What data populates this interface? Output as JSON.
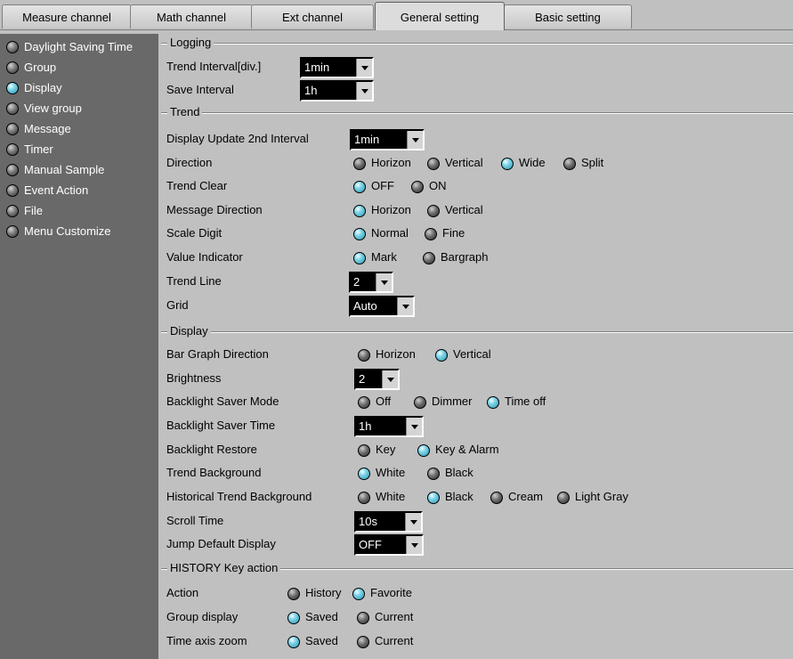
{
  "tabs": [
    "Measure channel",
    "Math channel",
    "Ext channel",
    "General setting",
    "Basic setting"
  ],
  "active_tab": "General setting",
  "sidebar": {
    "items": [
      {
        "label": "Daylight Saving Time",
        "selected": false
      },
      {
        "label": "Group",
        "selected": false
      },
      {
        "label": "Display",
        "selected": true
      },
      {
        "label": "View group",
        "selected": false
      },
      {
        "label": "Message",
        "selected": false
      },
      {
        "label": "Timer",
        "selected": false
      },
      {
        "label": "Manual Sample",
        "selected": false
      },
      {
        "label": "Event Action",
        "selected": false
      },
      {
        "label": "File",
        "selected": false
      },
      {
        "label": "Menu Customize",
        "selected": false
      }
    ]
  },
  "sections": {
    "logging": {
      "title": "Logging",
      "trend_interval": {
        "label": "Trend Interval[div.]",
        "value": "1min"
      },
      "save_interval": {
        "label": "Save Interval",
        "value": "1h"
      }
    },
    "trend": {
      "title": "Trend",
      "display_update": {
        "label": "Display Update 2nd Interval",
        "value": "1min"
      },
      "direction": {
        "label": "Direction",
        "options": [
          "Horizon",
          "Vertical",
          "Wide",
          "Split"
        ],
        "selected": "Wide"
      },
      "trend_clear": {
        "label": "Trend Clear",
        "options": [
          "OFF",
          "ON"
        ],
        "selected": "OFF"
      },
      "message_direction": {
        "label": "Message Direction",
        "options": [
          "Horizon",
          "Vertical"
        ],
        "selected": "Horizon"
      },
      "scale_digit": {
        "label": "Scale Digit",
        "options": [
          "Normal",
          "Fine"
        ],
        "selected": "Normal"
      },
      "value_indicator": {
        "label": "Value Indicator",
        "options": [
          "Mark",
          "Bargraph"
        ],
        "selected": "Mark"
      },
      "trend_line": {
        "label": "Trend Line",
        "value": "2"
      },
      "grid": {
        "label": "Grid",
        "value": "Auto"
      }
    },
    "display": {
      "title": "Display",
      "bar_graph_direction": {
        "label": "Bar Graph Direction",
        "options": [
          "Horizon",
          "Vertical"
        ],
        "selected": "Vertical"
      },
      "brightness": {
        "label": "Brightness",
        "value": "2"
      },
      "backlight_saver_mode": {
        "label": "Backlight Saver Mode",
        "options": [
          "Off",
          "Dimmer",
          "Time off"
        ],
        "selected": "Time off"
      },
      "backlight_saver_time": {
        "label": "Backlight Saver Time",
        "value": "1h"
      },
      "backlight_restore": {
        "label": "Backlight Restore",
        "options": [
          "Key",
          "Key & Alarm"
        ],
        "selected": "Key & Alarm"
      },
      "trend_background": {
        "label": "Trend Background",
        "options": [
          "White",
          "Black"
        ],
        "selected": "White"
      },
      "historical_trend_background": {
        "label": "Historical Trend Background",
        "options": [
          "White",
          "Black",
          "Cream",
          "Light Gray"
        ],
        "selected": "Black"
      },
      "scroll_time": {
        "label": "Scroll Time",
        "value": "10s"
      },
      "jump_default_display": {
        "label": "Jump Default Display",
        "value": "OFF"
      }
    },
    "history": {
      "title": "HISTORY Key action",
      "action": {
        "label": "Action",
        "options": [
          "History",
          "Favorite"
        ],
        "selected": "Favorite"
      },
      "group_display": {
        "label": "Group display",
        "options": [
          "Saved",
          "Current"
        ],
        "selected": "Saved"
      },
      "time_axis_zoom": {
        "label": "Time axis zoom",
        "options": [
          "Saved",
          "Current"
        ],
        "selected": "Saved"
      }
    }
  },
  "colors": {
    "sidebar_bg": "#696969",
    "panel_bg": "#c0c0c0",
    "radio_on": "#4fb8d4",
    "radio_off": "#3a3a3a"
  }
}
